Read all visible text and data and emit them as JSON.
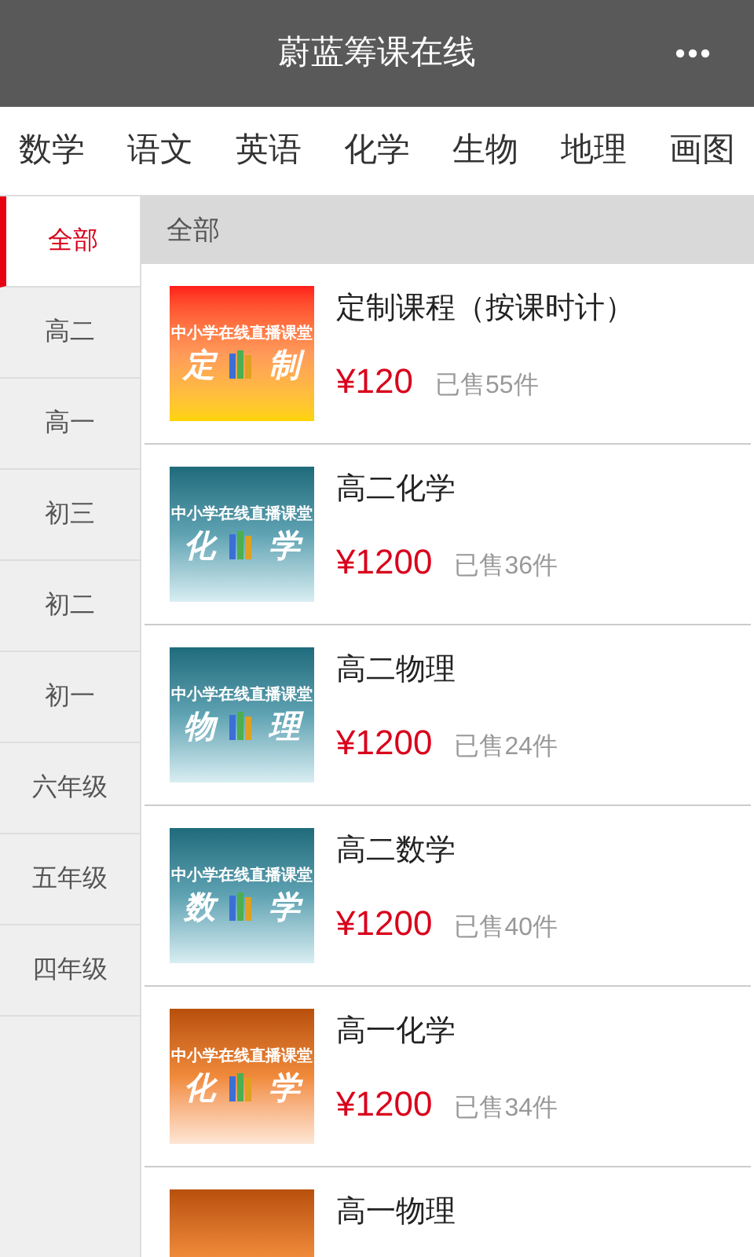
{
  "header": {
    "title": "蔚蓝筹课在线"
  },
  "subjects": [
    {
      "label": "数学",
      "selected": false
    },
    {
      "label": "语文",
      "selected": false
    },
    {
      "label": "英语",
      "selected": false
    },
    {
      "label": "化学",
      "selected": false
    },
    {
      "label": "生物",
      "selected": false
    },
    {
      "label": "地理",
      "selected": false
    },
    {
      "label": "画图",
      "selected": false
    }
  ],
  "grades": [
    {
      "label": "全部",
      "selected": true
    },
    {
      "label": "高二",
      "selected": false
    },
    {
      "label": "高一",
      "selected": false
    },
    {
      "label": "初三",
      "selected": false
    },
    {
      "label": "初二",
      "selected": false
    },
    {
      "label": "初一",
      "selected": false
    },
    {
      "label": "六年级",
      "selected": false
    },
    {
      "label": "五年级",
      "selected": false
    },
    {
      "label": "四年级",
      "selected": false
    }
  ],
  "section_title": "全部",
  "courses": [
    {
      "title": "定制课程（按课时计）",
      "price": "¥120",
      "sold": "已售55件",
      "cover": {
        "kind": "red",
        "caption": "中小学在线直播课堂",
        "left": "定",
        "right": "制"
      }
    },
    {
      "title": "高二化学",
      "price": "¥1200",
      "sold": "已售36件",
      "cover": {
        "kind": "teal",
        "caption": "中小学在线直播课堂",
        "left": "化",
        "right": "学"
      }
    },
    {
      "title": "高二物理",
      "price": "¥1200",
      "sold": "已售24件",
      "cover": {
        "kind": "teal",
        "caption": "中小学在线直播课堂",
        "left": "物",
        "right": "理"
      }
    },
    {
      "title": "高二数学",
      "price": "¥1200",
      "sold": "已售40件",
      "cover": {
        "kind": "teal",
        "caption": "中小学在线直播课堂",
        "left": "数",
        "right": "学"
      }
    },
    {
      "title": "高一化学",
      "price": "¥1200",
      "sold": "已售34件",
      "cover": {
        "kind": "orange",
        "caption": "中小学在线直播课堂",
        "left": "化",
        "right": "学"
      }
    },
    {
      "title": "高一物理",
      "cover": {
        "kind": "orange"
      }
    }
  ]
}
